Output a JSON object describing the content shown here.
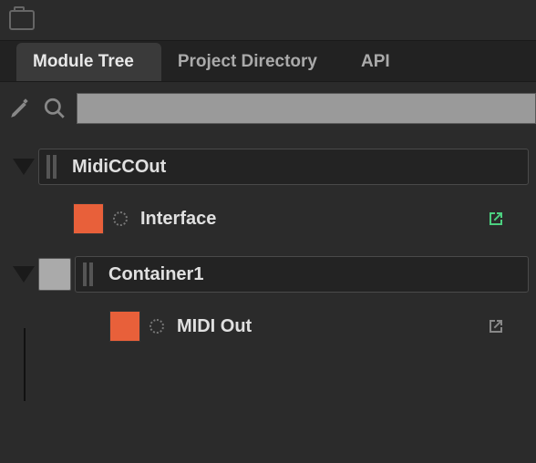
{
  "tabs": {
    "module_tree": "Module Tree",
    "project_directory": "Project Directory",
    "api": "API"
  },
  "search": {
    "value": ""
  },
  "tree": {
    "root": {
      "name": "MidiCCOut",
      "children": {
        "interface": {
          "label": "Interface",
          "color": "#e8603a"
        }
      }
    },
    "container": {
      "name": "Container1",
      "children": {
        "midi_out": {
          "label": "MIDI Out",
          "color": "#e8603a"
        }
      }
    }
  }
}
